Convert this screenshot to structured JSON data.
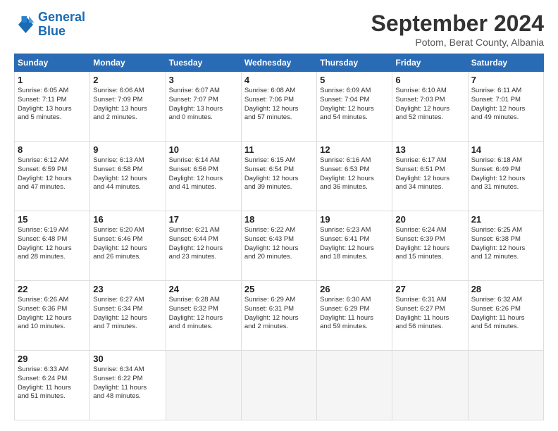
{
  "logo": {
    "line1": "General",
    "line2": "Blue"
  },
  "title": "September 2024",
  "subtitle": "Potom, Berat County, Albania",
  "days_of_week": [
    "Sunday",
    "Monday",
    "Tuesday",
    "Wednesday",
    "Thursday",
    "Friday",
    "Saturday"
  ],
  "weeks": [
    [
      {
        "day": "1",
        "info": "Sunrise: 6:05 AM\nSunset: 7:11 PM\nDaylight: 13 hours\nand 5 minutes."
      },
      {
        "day": "2",
        "info": "Sunrise: 6:06 AM\nSunset: 7:09 PM\nDaylight: 13 hours\nand 2 minutes."
      },
      {
        "day": "3",
        "info": "Sunrise: 6:07 AM\nSunset: 7:07 PM\nDaylight: 13 hours\nand 0 minutes."
      },
      {
        "day": "4",
        "info": "Sunrise: 6:08 AM\nSunset: 7:06 PM\nDaylight: 12 hours\nand 57 minutes."
      },
      {
        "day": "5",
        "info": "Sunrise: 6:09 AM\nSunset: 7:04 PM\nDaylight: 12 hours\nand 54 minutes."
      },
      {
        "day": "6",
        "info": "Sunrise: 6:10 AM\nSunset: 7:03 PM\nDaylight: 12 hours\nand 52 minutes."
      },
      {
        "day": "7",
        "info": "Sunrise: 6:11 AM\nSunset: 7:01 PM\nDaylight: 12 hours\nand 49 minutes."
      }
    ],
    [
      {
        "day": "8",
        "info": "Sunrise: 6:12 AM\nSunset: 6:59 PM\nDaylight: 12 hours\nand 47 minutes."
      },
      {
        "day": "9",
        "info": "Sunrise: 6:13 AM\nSunset: 6:58 PM\nDaylight: 12 hours\nand 44 minutes."
      },
      {
        "day": "10",
        "info": "Sunrise: 6:14 AM\nSunset: 6:56 PM\nDaylight: 12 hours\nand 41 minutes."
      },
      {
        "day": "11",
        "info": "Sunrise: 6:15 AM\nSunset: 6:54 PM\nDaylight: 12 hours\nand 39 minutes."
      },
      {
        "day": "12",
        "info": "Sunrise: 6:16 AM\nSunset: 6:53 PM\nDaylight: 12 hours\nand 36 minutes."
      },
      {
        "day": "13",
        "info": "Sunrise: 6:17 AM\nSunset: 6:51 PM\nDaylight: 12 hours\nand 34 minutes."
      },
      {
        "day": "14",
        "info": "Sunrise: 6:18 AM\nSunset: 6:49 PM\nDaylight: 12 hours\nand 31 minutes."
      }
    ],
    [
      {
        "day": "15",
        "info": "Sunrise: 6:19 AM\nSunset: 6:48 PM\nDaylight: 12 hours\nand 28 minutes."
      },
      {
        "day": "16",
        "info": "Sunrise: 6:20 AM\nSunset: 6:46 PM\nDaylight: 12 hours\nand 26 minutes."
      },
      {
        "day": "17",
        "info": "Sunrise: 6:21 AM\nSunset: 6:44 PM\nDaylight: 12 hours\nand 23 minutes."
      },
      {
        "day": "18",
        "info": "Sunrise: 6:22 AM\nSunset: 6:43 PM\nDaylight: 12 hours\nand 20 minutes."
      },
      {
        "day": "19",
        "info": "Sunrise: 6:23 AM\nSunset: 6:41 PM\nDaylight: 12 hours\nand 18 minutes."
      },
      {
        "day": "20",
        "info": "Sunrise: 6:24 AM\nSunset: 6:39 PM\nDaylight: 12 hours\nand 15 minutes."
      },
      {
        "day": "21",
        "info": "Sunrise: 6:25 AM\nSunset: 6:38 PM\nDaylight: 12 hours\nand 12 minutes."
      }
    ],
    [
      {
        "day": "22",
        "info": "Sunrise: 6:26 AM\nSunset: 6:36 PM\nDaylight: 12 hours\nand 10 minutes."
      },
      {
        "day": "23",
        "info": "Sunrise: 6:27 AM\nSunset: 6:34 PM\nDaylight: 12 hours\nand 7 minutes."
      },
      {
        "day": "24",
        "info": "Sunrise: 6:28 AM\nSunset: 6:32 PM\nDaylight: 12 hours\nand 4 minutes."
      },
      {
        "day": "25",
        "info": "Sunrise: 6:29 AM\nSunset: 6:31 PM\nDaylight: 12 hours\nand 2 minutes."
      },
      {
        "day": "26",
        "info": "Sunrise: 6:30 AM\nSunset: 6:29 PM\nDaylight: 11 hours\nand 59 minutes."
      },
      {
        "day": "27",
        "info": "Sunrise: 6:31 AM\nSunset: 6:27 PM\nDaylight: 11 hours\nand 56 minutes."
      },
      {
        "day": "28",
        "info": "Sunrise: 6:32 AM\nSunset: 6:26 PM\nDaylight: 11 hours\nand 54 minutes."
      }
    ],
    [
      {
        "day": "29",
        "info": "Sunrise: 6:33 AM\nSunset: 6:24 PM\nDaylight: 11 hours\nand 51 minutes."
      },
      {
        "day": "30",
        "info": "Sunrise: 6:34 AM\nSunset: 6:22 PM\nDaylight: 11 hours\nand 48 minutes."
      },
      {
        "day": "",
        "info": ""
      },
      {
        "day": "",
        "info": ""
      },
      {
        "day": "",
        "info": ""
      },
      {
        "day": "",
        "info": ""
      },
      {
        "day": "",
        "info": ""
      }
    ]
  ]
}
